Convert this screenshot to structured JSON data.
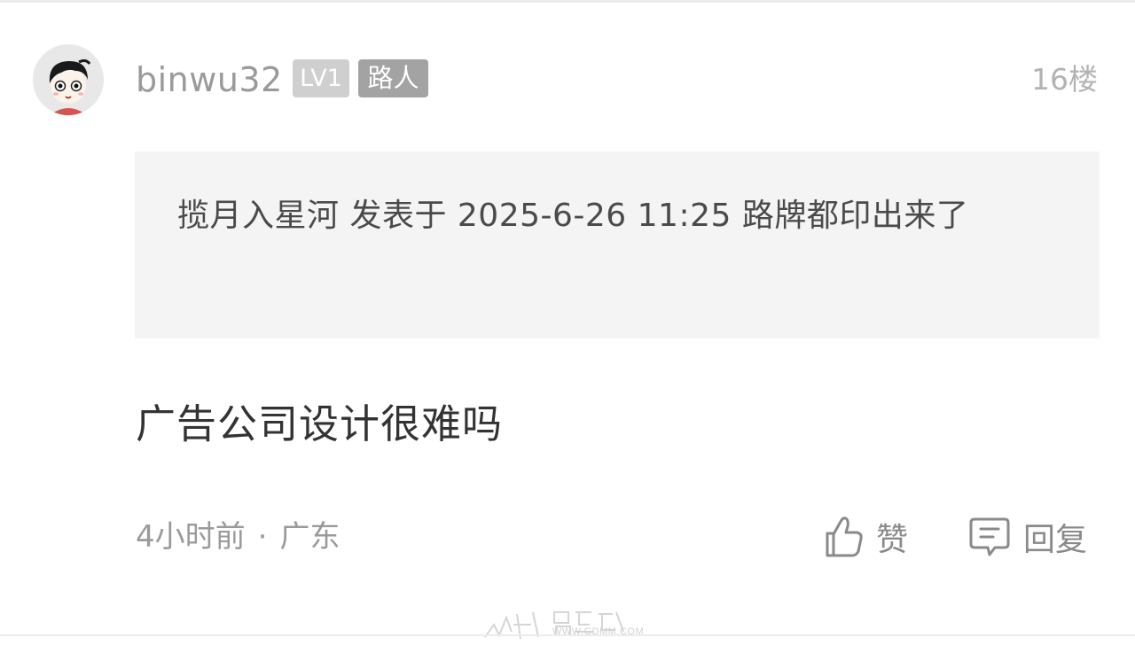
{
  "post": {
    "username": "binwu32",
    "level_badge": "LV1",
    "role_badge": "路人",
    "floor": "16楼",
    "quote_text": "揽月入星河 发表于 2025-6-26 11:25 路牌都印出来了",
    "content": "广告公司设计很难吗",
    "time_ago": "4小时前",
    "separator": "·",
    "location": "广东"
  },
  "actions": {
    "like_label": "赞",
    "reply_label": "回复"
  },
  "watermark": {
    "url": "WWW.GDMM.COM"
  },
  "icons": {
    "like": "thumbs-up-icon",
    "reply": "comment-icon"
  },
  "colors": {
    "badge_level": "#cfcfcf",
    "badge_role": "#a3a3a3",
    "quote_bg": "#f4f4f4",
    "text_primary": "#333333",
    "text_muted": "#9a9a9a"
  }
}
